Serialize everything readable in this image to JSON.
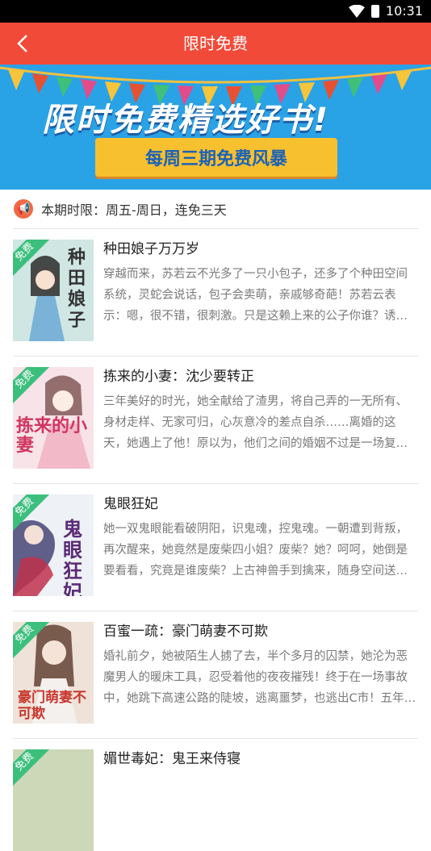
{
  "status_bar": {
    "time": "10:31"
  },
  "header": {
    "title": "限时免费"
  },
  "banner": {
    "headline": "限时免费精选好书!",
    "subline": "每周三期免费风暴"
  },
  "notice": {
    "text": "本期时限：周五-周日，连免三天"
  },
  "badge_label": "免费",
  "books": [
    {
      "title": "种田娘子万万岁",
      "desc": "穿越而来，苏若云不光多了一只小包子，还多了个种田空间系统，灵蛇会说话，包子会卖萌，亲戚够奇葩！苏若云表示：嗯，很不错，很刺激。只是这赖上来的公子你谁？诱拐…",
      "cover_bg": "#b8d9d4",
      "cover_text": "种田娘子",
      "cover_color": "#333333"
    },
    {
      "title": "拣来的小妻：沈少要转正",
      "desc": "三年美好的时光，她全献给了渣男，将自己弄的一无所有、身材走样、无家可归，心灰意冷的差点自杀……离婚的这天，她遇上了他！原以为，他们之间的婚姻不过是一场复仇和责…",
      "cover_bg": "#f3d5dd",
      "cover_text": "拣来的小妻",
      "cover_color": "#d0365f"
    },
    {
      "title": "鬼眼狂妃",
      "desc": "她一双鬼眼能看破阴阳，识鬼魂，控鬼魂。一朝遭到背叛，再次醒来，她竟然是废柴四小姐？废柴？她？呵呵，她倒是要看看，究竟是谁废柴？上古神兽手到擒来，随身空间送上…",
      "cover_bg": "#e9eef5",
      "cover_text": "鬼眼狂妃",
      "cover_color": "#5b2a76"
    },
    {
      "title": "百蜜一疏：豪门萌妻不可欺",
      "desc": "婚礼前夕，她被陌生人掳了去，半个多月的囚禁，她沦为恶魔男人的暖床工具，忍受着他的夜夜摧残！终于在一场事故中，她跳下高速公路的陡坡，逃离噩梦，也逃出C市！五年…",
      "cover_bg": "#e9d3c4",
      "cover_text": "豪门萌妻不可欺",
      "cover_color": "#c8352c"
    },
    {
      "title": "媚世毒妃：鬼王来侍寝",
      "desc": "",
      "cover_bg": "#cdd8b8",
      "cover_text": "",
      "cover_color": "#333333"
    }
  ]
}
